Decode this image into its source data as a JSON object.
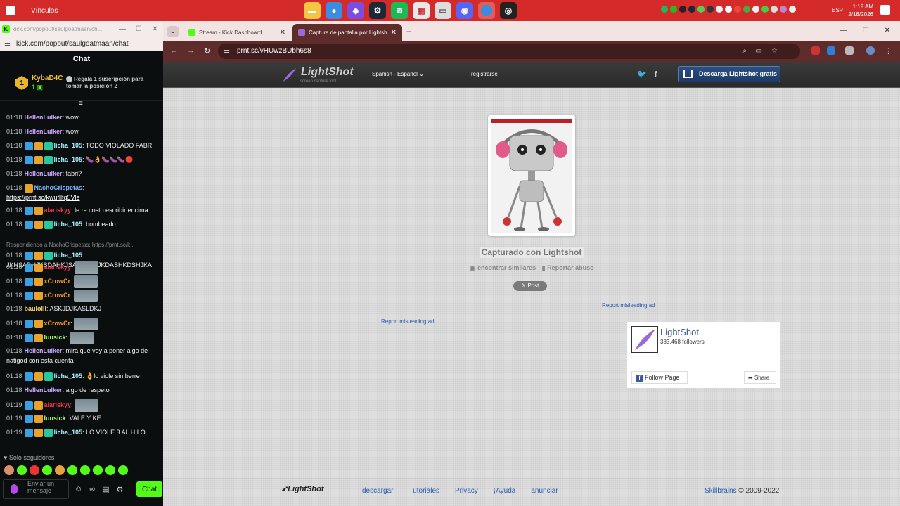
{
  "taskbar": {
    "window_title": "Vínculos",
    "clock_time": "1:19 AM",
    "clock_date": "2/18/2026",
    "language": "ESP"
  },
  "chat_window": {
    "title": "kick.com/popout/saulgoatmaan/ch...",
    "url": "kick.com/popout/saulgoatmaan/chat",
    "header": "Chat",
    "pinned": {
      "user": "KybaD4C",
      "badge": "1",
      "count": "1",
      "gift_text": "Regala 1 suscripción para tomar la posición 2"
    },
    "messages": [
      {
        "time": "01:18",
        "user": "HellenLulker",
        "color": "#c9a6ff",
        "text": "wow",
        "badges": ""
      },
      {
        "time": "01:18",
        "user": "HellenLulker",
        "color": "#c9a6ff",
        "text": "wow",
        "badges": ""
      },
      {
        "time": "01:18",
        "user": "licha_105",
        "color": "#a8f0ff",
        "text": "TODO VIOLADO FABRI",
        "badges": "scv"
      },
      {
        "time": "01:18",
        "user": "licha_105",
        "color": "#a8f0ff",
        "text": "🍆👌🍆🍆🍆🔴",
        "badges": "scv"
      },
      {
        "time": "01:18",
        "user": "HellenLulker",
        "color": "#c9a6ff",
        "text": "fabri?",
        "badges": ""
      },
      {
        "time": "01:18",
        "user": "NachoCrispetas",
        "color": "#7fb5ff",
        "text": "",
        "badges": "c",
        "link": "https://prnt.sc/kwuflltq5Vle"
      },
      {
        "time": "01:18",
        "user": "alariskyy",
        "color": "#e83a4a",
        "text": "le re costo escribir encima",
        "badges": "sc"
      },
      {
        "time": "01:18",
        "user": "licha_105",
        "color": "#a8f0ff",
        "text": "bombeado",
        "badges": "scv"
      },
      {
        "time": "01:18",
        "user": "licha_105",
        "color": "#a8f0ff",
        "text": "JKHSADHJKSDAHKJSADHJKHJKDASHKDSHJKA",
        "badges": "scv",
        "reply": "Respondiendo a NachoCrispetas: https://prnt.sc/k..."
      },
      {
        "time": "01:18",
        "user": "alariskyy",
        "color": "#e83a4a",
        "text": "",
        "badges": "sc",
        "emote": true
      },
      {
        "time": "01:18",
        "user": "xCrowCr",
        "color": "#ff9a1f",
        "text": "",
        "badges": "sc",
        "emote": true
      },
      {
        "time": "01:18",
        "user": "xCrowCr",
        "color": "#ff9a1f",
        "text": "",
        "badges": "sc",
        "emote": true
      },
      {
        "time": "01:18",
        "user": "baulolll",
        "color": "#ffd76a",
        "text": "ASKJDJKASLDKJ",
        "badges": ""
      },
      {
        "time": "01:18",
        "user": "xCrowCr",
        "color": "#ff9a1f",
        "text": "",
        "badges": "sc",
        "emote": true
      },
      {
        "time": "01:18",
        "user": "luusick",
        "color": "#a8ff6a",
        "text": "",
        "badges": "sc",
        "emote": true
      },
      {
        "time": "01:18",
        "user": "HellenLulker",
        "color": "#c9a6ff",
        "text": "mira que voy a poner algo de natigod con esta cuenta",
        "badges": ""
      },
      {
        "time": "01:18",
        "user": "licha_105",
        "color": "#a8f0ff",
        "text": "👌lo viole sin berre",
        "badges": "scv"
      },
      {
        "time": "01:18",
        "user": "HellenLulker",
        "color": "#c9a6ff",
        "text": "algo de respeto",
        "badges": ""
      },
      {
        "time": "01:19",
        "user": "alariskyy",
        "color": "#e83a4a",
        "text": "",
        "badges": "sc",
        "emote": true
      },
      {
        "time": "01:19",
        "user": "luusick",
        "color": "#a8ff6a",
        "text": "VALE Y KE",
        "badges": "sc"
      },
      {
        "time": "01:19",
        "user": "licha_105",
        "color": "#a8f0ff",
        "text": "LO VIOLE 3 AL HILO",
        "badges": "scv"
      }
    ],
    "followers_only": "Solo seguidores",
    "input_placeholder": "Enviar un mensaje",
    "send_label": "Chat"
  },
  "browser": {
    "tabs": [
      {
        "label": "Stream - Kick Dashboard",
        "active": false
      },
      {
        "label": "Captura de pantalla por Lightsh",
        "active": true
      }
    ],
    "url": "prnt.sc/vHUwzBUbh6s8"
  },
  "lightshot": {
    "logo": "LightShot",
    "tagline": "screen capture tool",
    "language": "Spanish - Español",
    "register": "registrarse",
    "download_button": "Descarga Lightshot gratis",
    "caption": "Capturado con Lightshot",
    "find_similar": "encontrar similares",
    "report_abuse": "Reportar abuso",
    "post_button": "Post",
    "ad_report_1": "Report misleading ad",
    "ad_report_2": "Report misleading ad",
    "fb": {
      "name": "LightShot",
      "followers": "383,468 followers",
      "follow": "Follow Page",
      "share": "Share"
    },
    "footer": {
      "logo": "LightShot",
      "links": [
        "descargar",
        "Tutoriales",
        "Privacy",
        "¡Ayuda",
        "anunciar"
      ],
      "company": "Skillbrains",
      "copyright": "© 2009-2022"
    }
  }
}
